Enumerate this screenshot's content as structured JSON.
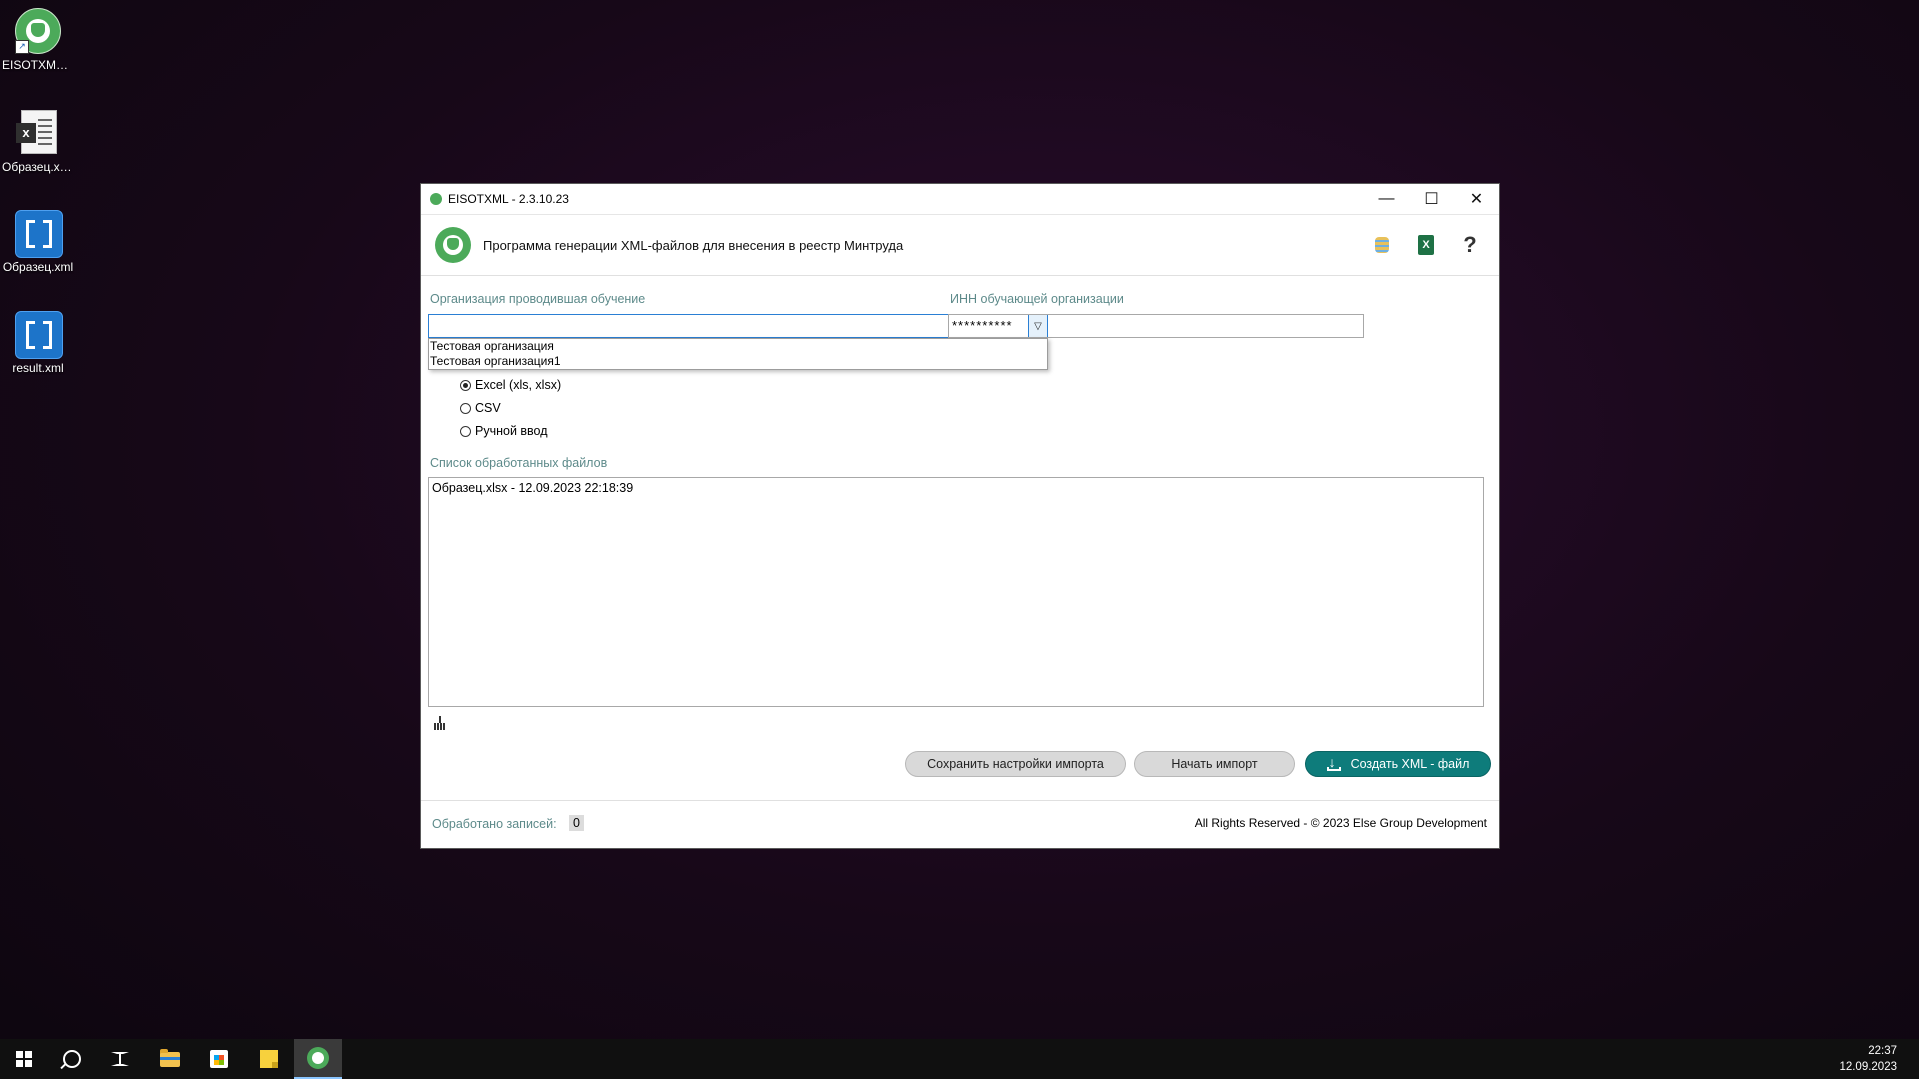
{
  "desktop": {
    "icons": [
      {
        "label": "EISOTXML...."
      },
      {
        "label": "Образец.xlsx"
      },
      {
        "label": "Образец.xml"
      },
      {
        "label": "result.xml"
      }
    ]
  },
  "window": {
    "title": "EISOTXML - 2.3.10.23",
    "controls": {
      "minimize": "—",
      "maximize": "☐",
      "close": "✕"
    },
    "header": {
      "title": "Программа генерации XML-файлов для внесения в реестр Минтруда",
      "icons": [
        "database-icon",
        "excel-export-icon",
        "help-icon"
      ],
      "help_glyph": "?",
      "excel_glyph": "X"
    },
    "org": {
      "label": "Организация проводившая обучение",
      "value": "",
      "options": [
        "Тестовая организация",
        "Тестовая организация1"
      ]
    },
    "inn": {
      "label": "ИНН обучающей организации",
      "value": "**********"
    },
    "source": {
      "options": [
        {
          "label": "Excel (xls, xlsx)",
          "checked": true
        },
        {
          "label": "CSV",
          "checked": false
        },
        {
          "label": "Ручной ввод",
          "checked": false
        }
      ]
    },
    "files": {
      "label": "Список обработанных файлов",
      "items": [
        "Образец.xlsx - 12.09.2023 22:18:39"
      ]
    },
    "buttons": {
      "save_settings": "Сохранить настройки импорта",
      "start_import": "Начать импорт",
      "create_xml": "Создать XML - файл"
    },
    "footer": {
      "processed_label": "Обработано записей:",
      "processed_count": "0",
      "copyright": "All Rights Reserved - © 2023 Else Group Development"
    }
  },
  "taskbar": {
    "items": [
      "start-icon",
      "search-icon",
      "task-view-icon",
      "file-explorer-icon",
      "store-icon",
      "sticky-notes-icon",
      "eisotxml-icon"
    ],
    "active": "eisotxml-icon",
    "clock": {
      "time": "22:37",
      "date": "12.09.2023"
    }
  },
  "colors": {
    "accent_teal": "#0e7c7b",
    "label_color": "#5d8a8a",
    "logo_green": "#4caa5a"
  }
}
